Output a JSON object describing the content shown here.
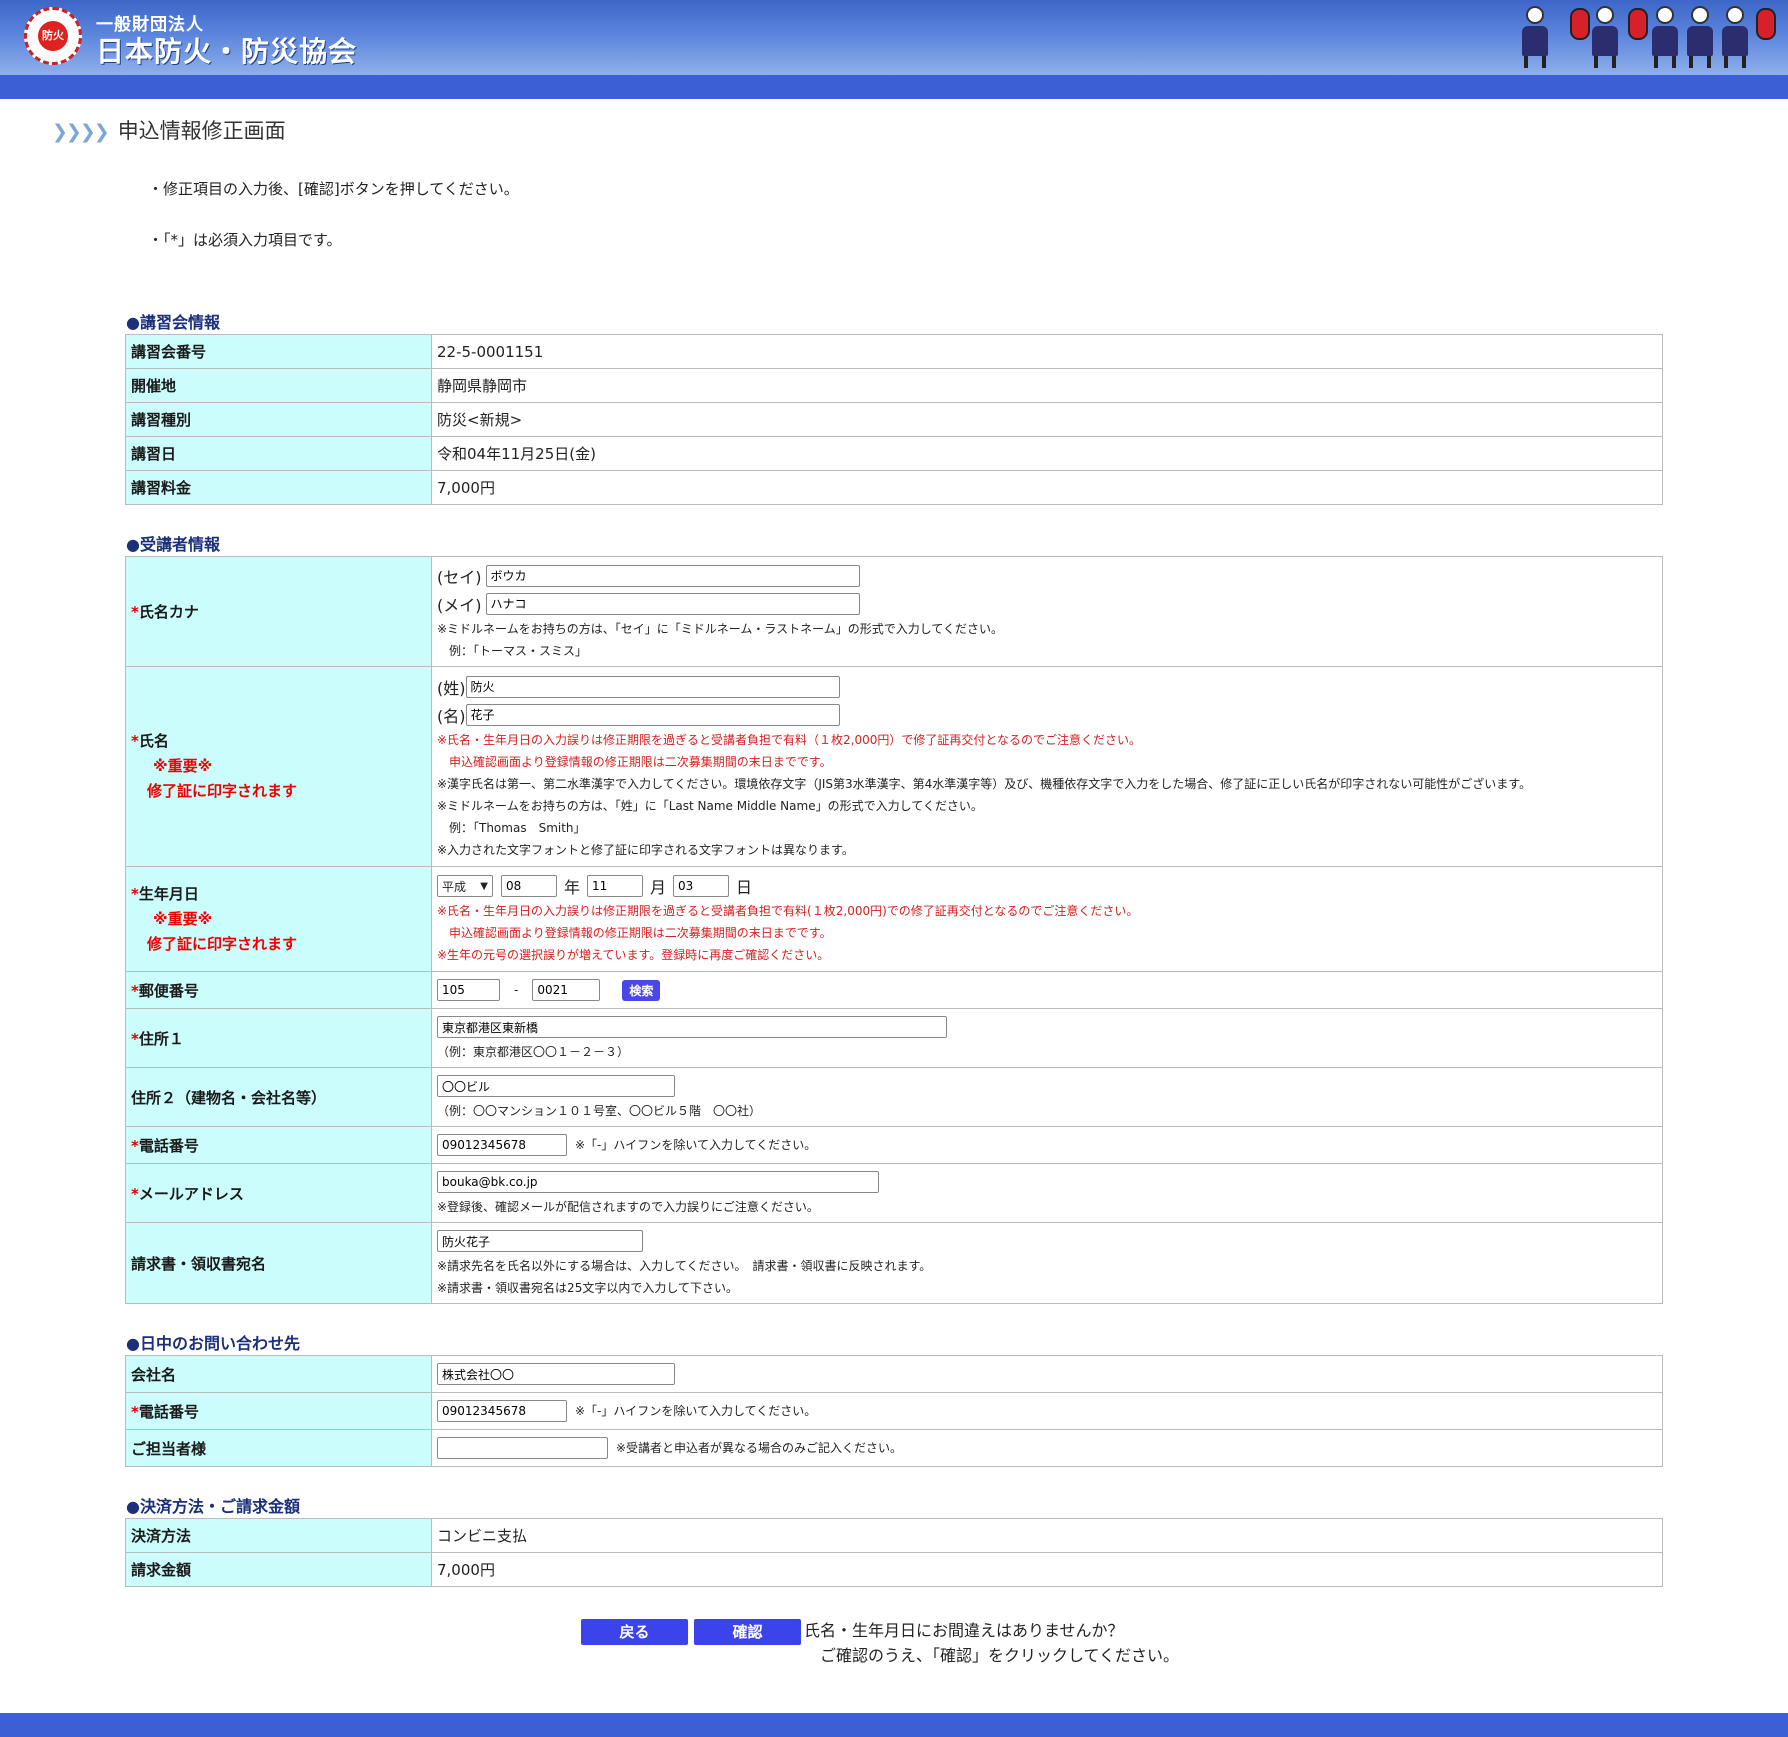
{
  "header": {
    "org_sub": "一般財団法人",
    "org_main": "日本防火・防災協会",
    "emblem_text": "防火"
  },
  "page": {
    "title": "申込情報修正画面",
    "notes": [
      "・修正項目の入力後、[確認]ボタンを押してください。",
      "・「*」は必須入力項目です。"
    ]
  },
  "course": {
    "heading": "●講習会情報",
    "rows": [
      {
        "label": "講習会番号",
        "value": "22-5-0001151"
      },
      {
        "label": "開催地",
        "value": "静岡県静岡市"
      },
      {
        "label": "講習種別",
        "value": "防災<新規>"
      },
      {
        "label": "講習日",
        "value": "令和04年11月25日(金)"
      },
      {
        "label": "講習料金",
        "value": "7,000円"
      }
    ]
  },
  "trainee": {
    "heading": "●受講者情報",
    "required_mark": "*",
    "important": "※重要※",
    "print_note": "修了証に印字されます",
    "kana": {
      "label": "氏名カナ",
      "sei_label": "(セイ)",
      "sei_value": "ボウカ",
      "mei_label": "(メイ)",
      "mei_value": "ハナコ",
      "note1": "※ミドルネームをお持ちの方は、「セイ」に「ミドルネーム・ラストネーム」の形式で入力してください。",
      "note2": "　例：「トーマス・スミス」"
    },
    "name": {
      "label": "氏名",
      "sei_label": "(姓)",
      "sei_value": "防火",
      "mei_label": "(名)",
      "mei_value": "花子",
      "warn1": "※氏名・生年月日の入力誤りは修正期限を過ぎると受講者負担で有料（１枚2,000円）で修了証再交付となるのでご注意ください。",
      "warn2": "　申込確認画面より登録情報の修正期限は二次募集期間の末日までです。",
      "note1": "※漢字氏名は第一、第二水準漢字で入力してください。環境依存文字（JIS第3水準漢字、第4水準漢字等）及び、機種依存文字で入力をした場合、修了証に正しい氏名が印字されない可能性がございます。",
      "note2": "※ミドルネームをお持ちの方は、「姓」に「Last Name Middle Name」の形式で入力してください。",
      "note3": "　例：「Thomas　Smith」",
      "note4": "※入力された文字フォントと修了証に印字される文字フォントは異なります。"
    },
    "birth": {
      "label": "生年月日",
      "era": "平成",
      "year": "08",
      "year_unit": "年",
      "month": "11",
      "month_unit": "月",
      "day": "03",
      "day_unit": "日",
      "warn1": "※氏名・生年月日の入力誤りは修正期限を過ぎると受講者負担で有料(１枚2,000円)での修了証再交付となるのでご注意ください。",
      "warn2": "　申込確認画面より登録情報の修正期限は二次募集期間の末日までです。",
      "warn3": "※生年の元号の選択誤りが増えています。登録時に再度ご確認ください。"
    },
    "postal": {
      "label": "郵便番号",
      "part1": "105",
      "sep": "-",
      "part2": "0021",
      "search": "検索"
    },
    "address1": {
      "label": "住所１",
      "value": "東京都港区東新橋",
      "example": "（例：東京都港区〇〇１－２－３）"
    },
    "address2": {
      "label": "住所２（建物名・会社名等）",
      "value": "〇〇ビル",
      "example": "（例：〇〇マンション１０１号室、〇〇ビル５階　〇〇社）"
    },
    "phone": {
      "label": "電話番号",
      "value": "09012345678",
      "note": "※「-」ハイフンを除いて入力してください。"
    },
    "email": {
      "label": "メールアドレス",
      "value": "bouka@bk.co.jp",
      "note": "※登録後、確認メールが配信されますので入力誤りにご注意ください。"
    },
    "invoice": {
      "label": "請求書・領収書宛名",
      "value": "防火花子",
      "note1": "※請求先名を氏名以外にする場合は、入力してください。　請求書・領収書に反映されます。",
      "note2": "※請求書・領収書宛名は25文字以内で入力して下さい。"
    }
  },
  "daytime": {
    "heading": "●日中のお問い合わせ先",
    "company": {
      "label": "会社名",
      "value": "株式会社〇〇"
    },
    "phone": {
      "label": "電話番号",
      "value": "09012345678",
      "note": "※「-」ハイフンを除いて入力してください。"
    },
    "person": {
      "label": "ご担当者様",
      "value": "",
      "note": "※受講者と申込者が異なる場合のみご記入ください。"
    }
  },
  "payment": {
    "heading": "●決済方法・ご請求金額",
    "rows": [
      {
        "label": "決済方法",
        "value": "コンビニ支払"
      },
      {
        "label": "請求金額",
        "value": "7,000円"
      }
    ]
  },
  "footer": {
    "back": "戻る",
    "confirm": "確認",
    "msg1": "氏名・生年月日にお間違えはありませんか？",
    "msg2": "ご確認のうえ、「確認」をクリックしてください。"
  }
}
